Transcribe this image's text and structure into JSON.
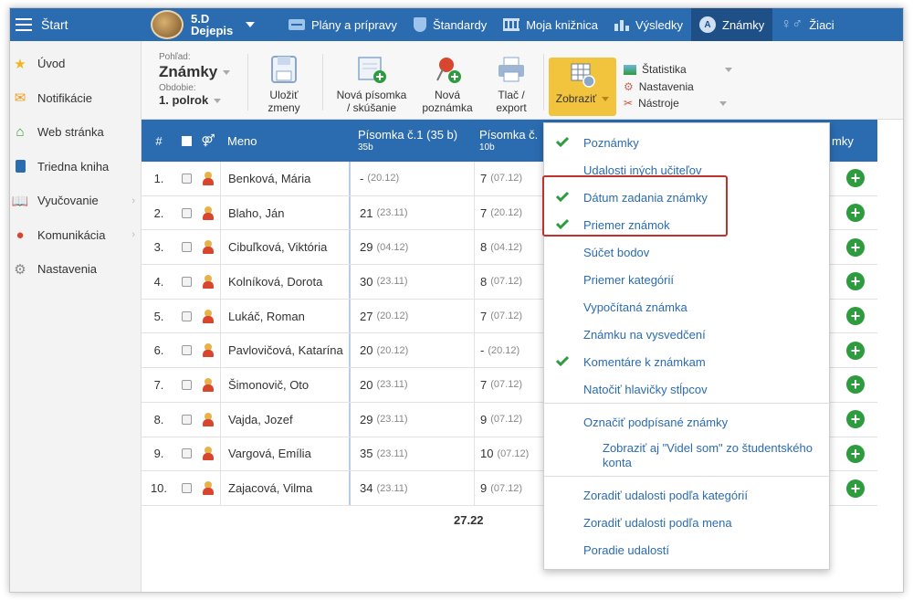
{
  "topbar": {
    "start_label": "Štart",
    "class_name": "5.D",
    "class_subject": "Dejepis",
    "nav": [
      {
        "label": "Plány a prípravy",
        "icon": "plans-icon"
      },
      {
        "label": "Štandardy",
        "icon": "shield-icon"
      },
      {
        "label": "Moja knižnica",
        "icon": "library-icon"
      },
      {
        "label": "Výsledky",
        "icon": "bar-chart-icon"
      },
      {
        "label": "Známky",
        "icon": "grades-icon",
        "active": true
      },
      {
        "label": "Žiaci",
        "icon": "students-icon"
      }
    ]
  },
  "sidebar": {
    "items": [
      {
        "label": "Úvod",
        "icon": "star-icon"
      },
      {
        "label": "Notifikácie",
        "icon": "envelope-icon"
      },
      {
        "label": "Web stránka",
        "icon": "home-icon"
      },
      {
        "label": "Triedna kniha",
        "icon": "class-book-icon"
      },
      {
        "label": "Vyučovanie",
        "icon": "book-icon",
        "has_arrow": true
      },
      {
        "label": "Komunikácia",
        "icon": "chat-icon",
        "has_arrow": true
      },
      {
        "label": "Nastavenia",
        "icon": "gear-icon"
      }
    ],
    "arrow": "›"
  },
  "toolbar": {
    "pohlad_label": "Pohľad:",
    "pohlad_value": "Známky",
    "obdobie_label": "Obdobie:",
    "obdobie_value": "1. polrok",
    "save_l1": "Uložiť",
    "save_l2": "zmeny",
    "new_test_l1": "Nová písomka",
    "new_test_l2": "/ skúšanie",
    "new_note_l1": "Nová",
    "new_note_l2": "poznámka",
    "print_l1": "Tlač /",
    "print_l2": "export",
    "show_label": "Zobraziť",
    "stats_label": "Štatistika",
    "settings_label": "Nastavenia",
    "tools_label": "Nástroje"
  },
  "table": {
    "headers": {
      "num": "#",
      "gender": "⚤",
      "name": "Meno",
      "test1_title": "Písomka č.1 (35 b)",
      "test1_sub": "35b",
      "test2_title": "Písomka č.",
      "test2_sub": "10b",
      "grades_tail": "mky"
    },
    "rows": [
      {
        "num": "1.",
        "name": "Benková, Mária",
        "t1": "-",
        "t1_date": "(20.12)",
        "t2": "7",
        "t2_date": "(07.12)"
      },
      {
        "num": "2.",
        "name": "Blaho, Ján",
        "t1": "21",
        "t1_date": "(23.11)",
        "t2": "7",
        "t2_date": "(20.12)"
      },
      {
        "num": "3.",
        "name": "Cibuľková, Viktória",
        "t1": "29",
        "t1_date": "(04.12)",
        "t2": "8",
        "t2_date": "(04.12)"
      },
      {
        "num": "4.",
        "name": "Kolníková, Dorota",
        "t1": "30",
        "t1_date": "(23.11)",
        "t2": "8",
        "t2_date": "(07.12)"
      },
      {
        "num": "5.",
        "name": "Lukáč, Roman",
        "t1": "27",
        "t1_date": "(20.12)",
        "t2": "7",
        "t2_date": "(07.12)"
      },
      {
        "num": "6.",
        "name": "Pavlovičová, Katarína",
        "t1": "20",
        "t1_date": "(20.12)",
        "t2": "-",
        "t2_date": "(20.12)"
      },
      {
        "num": "7.",
        "name": "Šimonovič, Oto",
        "t1": "20",
        "t1_date": "(23.11)",
        "t2": "7",
        "t2_date": "(07.12)"
      },
      {
        "num": "8.",
        "name": "Vajda, Jozef",
        "t1": "29",
        "t1_date": "(23.11)",
        "t2": "9",
        "t2_date": "(07.12)"
      },
      {
        "num": "9.",
        "name": "Vargová, Emília",
        "t1": "35",
        "t1_date": "(23.11)",
        "t2": "10",
        "t2_date": "(07.12)"
      },
      {
        "num": "10.",
        "name": "Zajacová, Vilma",
        "t1": "34",
        "t1_date": "(23.11)",
        "t2": "9",
        "t2_date": "(07.12)"
      }
    ],
    "average": "27.22",
    "add_symbol": "+"
  },
  "dropdown": {
    "items": [
      {
        "label": "Poznámky",
        "checked": true
      },
      {
        "label": "Udalosti iných učiteľov",
        "checked": false
      },
      {
        "label": "Dátum zadania známky",
        "checked": true
      },
      {
        "label": "Priemer známok",
        "checked": true
      },
      {
        "label": "Súčet bodov",
        "checked": false
      },
      {
        "label": "Priemer kategórií",
        "checked": false
      },
      {
        "label": "Vypočítaná známka",
        "checked": false
      },
      {
        "label": "Známku na vysvedčení",
        "checked": false
      },
      {
        "label": "Komentáre k známkam",
        "checked": true
      },
      {
        "label": "Natočiť hlavičky stĺpcov",
        "checked": false
      },
      {
        "label": "Označiť podpísané známky",
        "checked": false
      },
      {
        "label": "Zobraziť aj \"Videl som\" zo študentského konta",
        "checked": false
      },
      {
        "label": "Zoradiť udalosti podľa kategórií",
        "checked": false
      },
      {
        "label": "Zoradiť udalosti podľa mena",
        "checked": false
      },
      {
        "label": "Poradie udalostí",
        "checked": false
      }
    ]
  },
  "colors": {
    "primary": "#2b6bb0",
    "active_nav": "#1e4f86",
    "accent_button": "#f2c33d",
    "check_green": "#2e9b3e",
    "highlight_red": "#c0302c"
  }
}
